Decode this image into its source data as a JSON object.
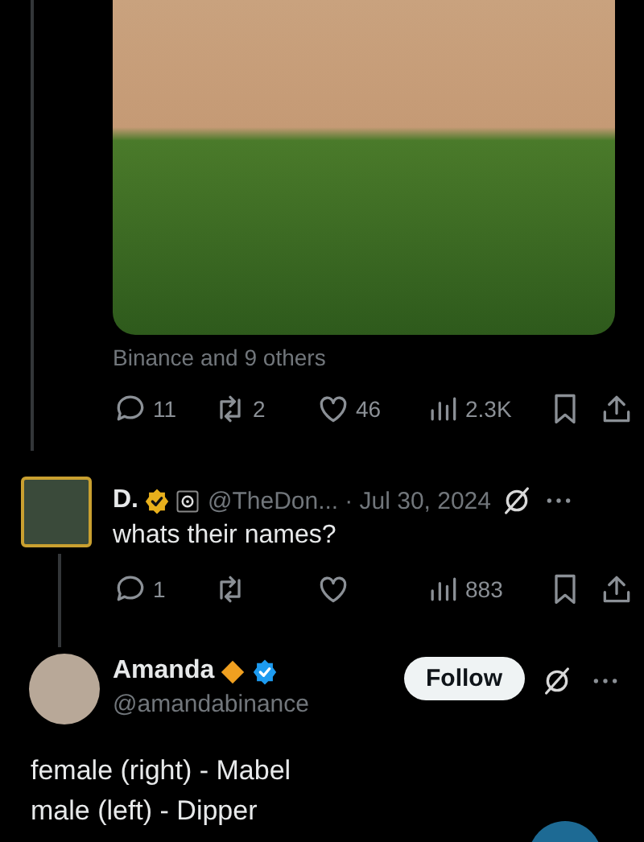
{
  "post": {
    "liked_by": "Binance and 9 others",
    "actions": [
      {
        "kind": "reply",
        "count": "11"
      },
      {
        "kind": "repost",
        "count": "2"
      },
      {
        "kind": "like",
        "count": "46"
      },
      {
        "kind": "views",
        "count": "2.3K"
      },
      {
        "kind": "bookmark"
      },
      {
        "kind": "share"
      }
    ]
  },
  "reply": {
    "name": "D.",
    "badges": [
      {
        "kind": "gold-check"
      },
      {
        "kind": "square-emblem"
      }
    ],
    "handle": "@TheDon...",
    "date": "· Jul 30, 2024",
    "text": "whats their names?",
    "actions": [
      {
        "kind": "reply",
        "count": "1"
      },
      {
        "kind": "repost"
      },
      {
        "kind": "like"
      },
      {
        "kind": "views",
        "count": "883"
      },
      {
        "kind": "bookmark"
      },
      {
        "kind": "share"
      }
    ]
  },
  "answer": {
    "name": "Amanda",
    "badges": [
      {
        "kind": "orange-diamond"
      },
      {
        "kind": "blue-check"
      }
    ],
    "handle": "@amandabinance",
    "follow_label": "Follow",
    "lines": [
      "female (right) - Mabel",
      "male (left) - Dipper"
    ]
  }
}
